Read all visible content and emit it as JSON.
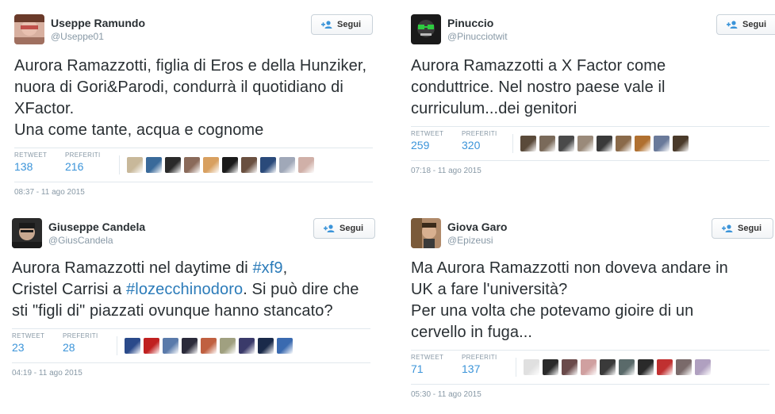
{
  "tweets": [
    {
      "name": "Useppe Ramundo",
      "handle": "@Useppe01",
      "follow_label": "Segui",
      "text_parts": [
        {
          "t": "Aurora Ramazzotti, figlia di Eros e della Hunziker, nuora di Gori&Parodi, condurrà il quotidiano di XFactor.\nUna come tante, acqua e cognome",
          "tag": false
        }
      ],
      "retweet_label": "RETWEET",
      "retweet_count": "138",
      "favorites_label": "PREFERITI",
      "favorites_count": "216",
      "timestamp": "08:37 - 11 ago 2015",
      "face_colors": [
        "#c8b89a",
        "#3a6a9a",
        "#2a2a2a",
        "#8a6a5a",
        "#d8a060",
        "#1a1a1a",
        "#6a5040",
        "#2a4a7a",
        "#a0a8b8",
        "#d0b0a8"
      ]
    },
    {
      "name": "Pinuccio",
      "handle": "@Pinucciotwit",
      "follow_label": "Segui",
      "text_parts": [
        {
          "t": "Aurora Ramazzotti a X Factor come conduttrice. Nel nostro paese vale il curriculum...dei genitori",
          "tag": false
        }
      ],
      "retweet_label": "RETWEET",
      "retweet_count": "259",
      "favorites_label": "PREFERITI",
      "favorites_count": "320",
      "timestamp": "07:18 - 11 ago 2015",
      "face_colors": [
        "#5a4a3a",
        "#7a6a5a",
        "#4a4a4a",
        "#9a8a7a",
        "#3a3a3a",
        "#8a6a4a",
        "#b07030",
        "#6a7a9a",
        "#4a3a2a"
      ]
    },
    {
      "name": "Giuseppe Candela",
      "handle": "@GiusCandela",
      "follow_label": "Segui",
      "text_parts": [
        {
          "t": "Aurora Ramazzotti nel daytime di ",
          "tag": false
        },
        {
          "t": "#xf9",
          "tag": true
        },
        {
          "t": ",\nCristel Carrisi a ",
          "tag": false
        },
        {
          "t": "#lozecchinodoro",
          "tag": true
        },
        {
          "t": ". Si può dire che sti \"figli di\" piazzati ovunque hanno stancato?",
          "tag": false
        }
      ],
      "retweet_label": "RETWEET",
      "retweet_count": "23",
      "favorites_label": "PREFERITI",
      "favorites_count": "28",
      "timestamp": "04:19 - 11 ago 2015",
      "face_colors": [
        "#2a4a8a",
        "#c02020",
        "#5a7aaa",
        "#2a2a3a",
        "#c06040",
        "#a0a080",
        "#3a3a6a",
        "#1a2a4a",
        "#3a6ab0"
      ]
    },
    {
      "name": "Giova Garo",
      "handle": "@Epizeusi",
      "follow_label": "Segui",
      "text_parts": [
        {
          "t": "Ma Aurora Ramazzotti non doveva andare in UK a fare l'università?\nPer una volta che potevamo gioire di un cervello in fuga...",
          "tag": false
        }
      ],
      "retweet_label": "RETWEET",
      "retweet_count": "71",
      "favorites_label": "PREFERITI",
      "favorites_count": "137",
      "timestamp": "05:30 - 11 ago 2015",
      "face_colors": [
        "#e0e0e0",
        "#2a2a2a",
        "#6a4a4a",
        "#d0a0a0",
        "#3a3a3a",
        "#5a6a6a",
        "#2a2a2a",
        "#c03030",
        "#7a6a6a",
        "#b0a0c0"
      ]
    }
  ]
}
